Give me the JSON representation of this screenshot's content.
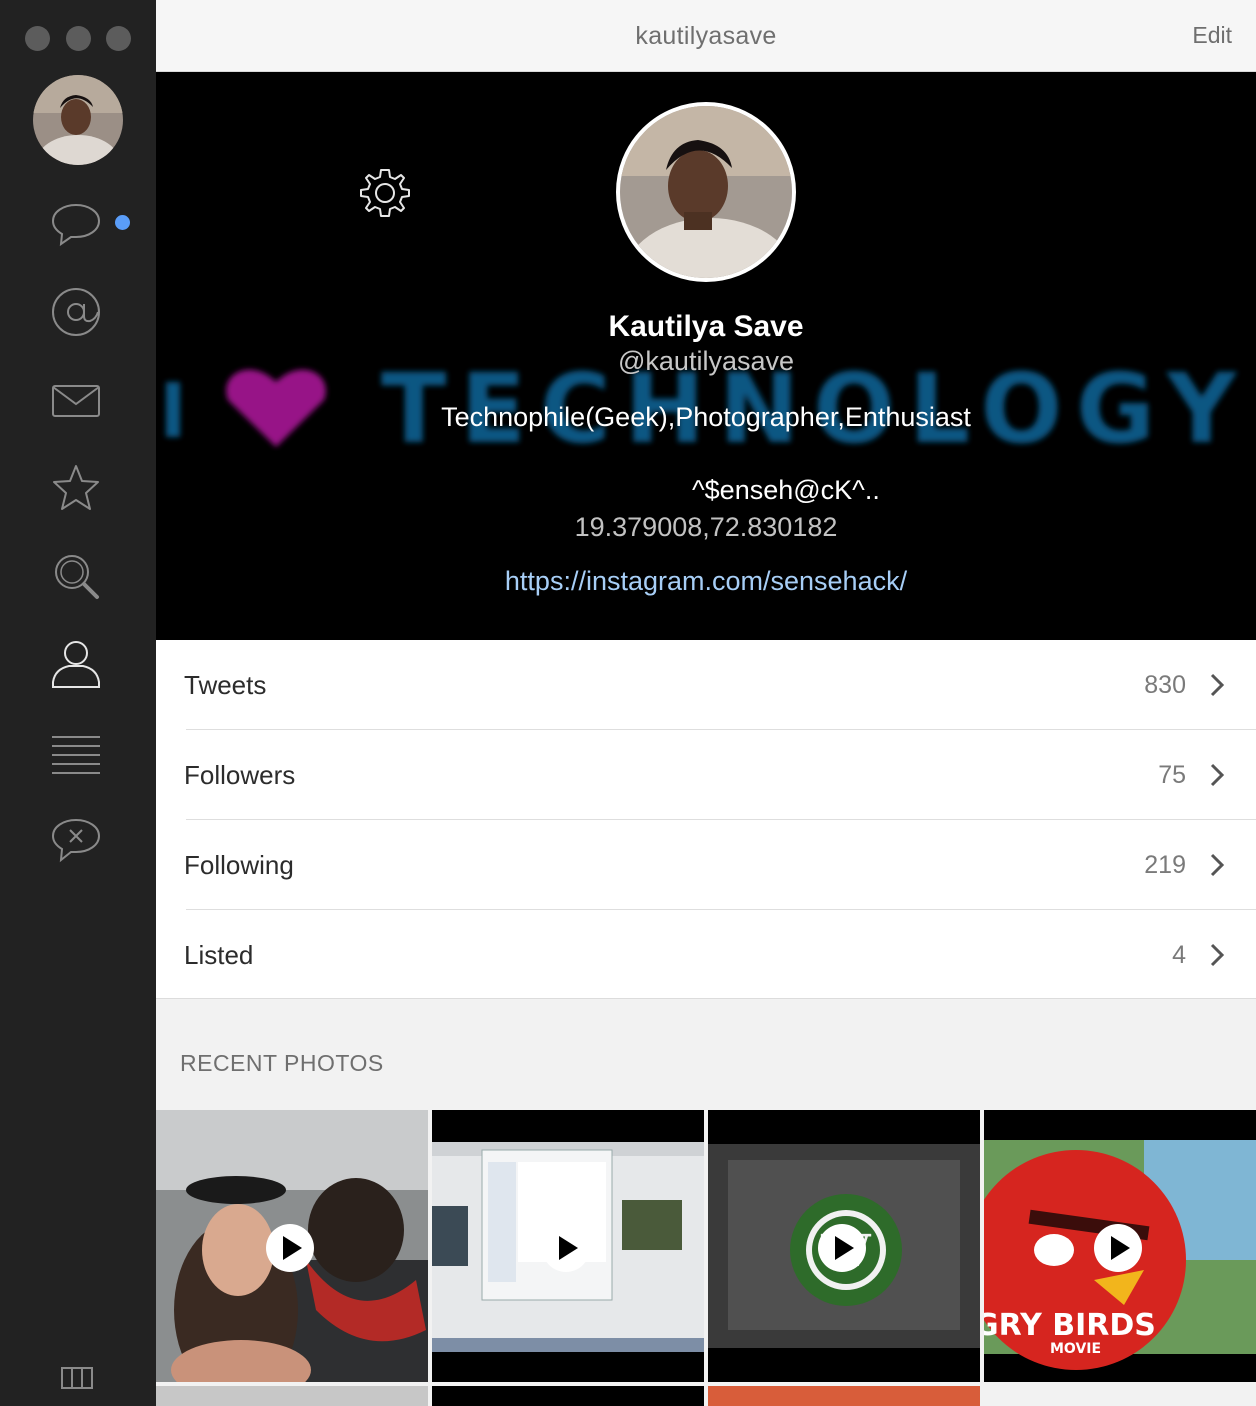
{
  "window": {
    "title": "kautilyasave",
    "edit_label": "Edit"
  },
  "sidebar": {
    "items": [
      {
        "name": "messages",
        "icon": "speech-bubble-icon",
        "unread": true
      },
      {
        "name": "mentions",
        "icon": "at-sign-icon"
      },
      {
        "name": "direct-messages",
        "icon": "envelope-icon"
      },
      {
        "name": "favorites",
        "icon": "star-icon"
      },
      {
        "name": "search",
        "icon": "magnifier-icon"
      },
      {
        "name": "profile",
        "icon": "person-icon",
        "selected": true
      },
      {
        "name": "lists",
        "icon": "list-lines-icon"
      },
      {
        "name": "muted",
        "icon": "muted-bubble-icon"
      }
    ],
    "bottom_icon": "columns-icon"
  },
  "profile": {
    "name": "Kautilya Save",
    "handle": "@kautilyasave",
    "bio_line1": "Technophile(Geek),Photographer,Enthusiast",
    "bio_line2": "^$enseh@cK^..",
    "location": "19.379008,72.830182",
    "url": "https://instagram.com/sensehack/",
    "banner_text": "I ♥ TECHNOLOGY"
  },
  "stats": [
    {
      "label": "Tweets",
      "count": "830"
    },
    {
      "label": "Followers",
      "count": "75"
    },
    {
      "label": "Following",
      "count": "219"
    },
    {
      "label": "Listed",
      "count": "4"
    }
  ],
  "recent_photos": {
    "title": "RECENT PHOTOS",
    "items": [
      {
        "caption": "",
        "scene": "woman-with-dog-in-car",
        "video": true
      },
      {
        "caption": "",
        "scene": "mac-screenshot-dialog",
        "video": true
      },
      {
        "caption": "",
        "scene": "wordpress-logo",
        "video": true
      },
      {
        "caption": "",
        "scene": "angry-birds-movie",
        "video": true
      }
    ]
  },
  "colors": {
    "sidebar": "#222222",
    "accent_dot": "#5a9df8",
    "link": "#a7cef6",
    "banner_heart": "#a0168f",
    "banner_text": "#0b5b8a"
  }
}
